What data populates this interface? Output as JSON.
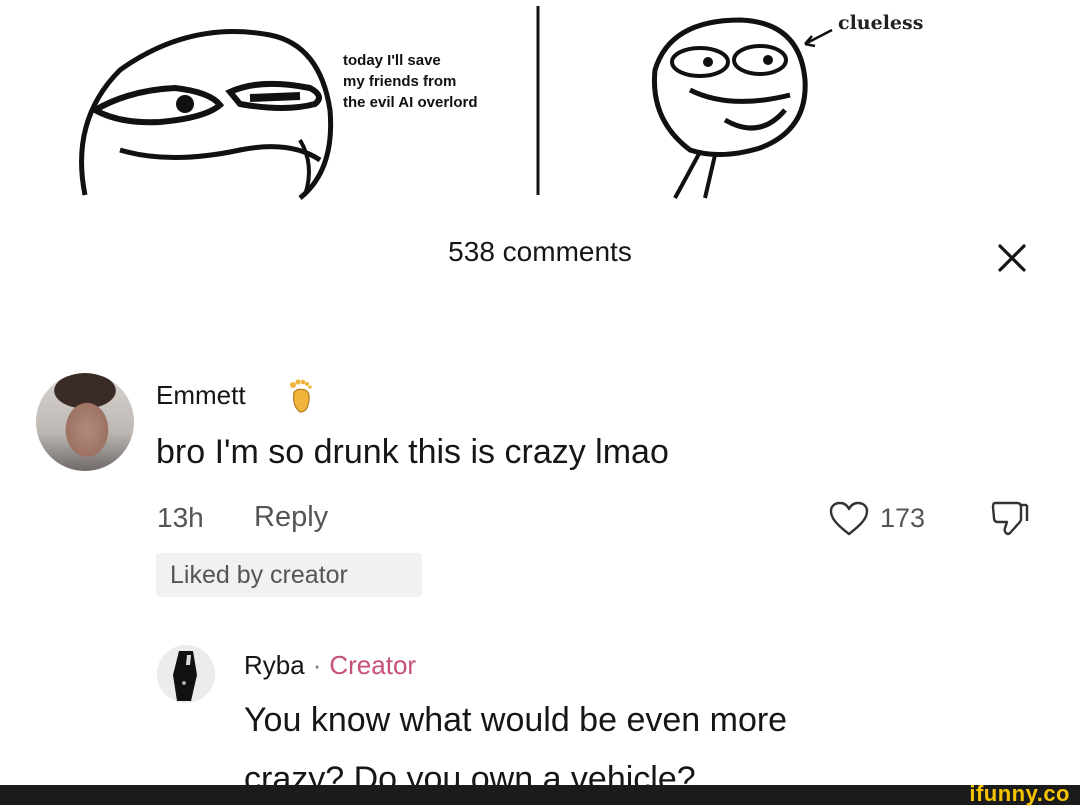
{
  "meme": {
    "caption_lines": [
      "today I'll save",
      "my friends from",
      "the evil AI overlord"
    ],
    "label": "clueless"
  },
  "comments_panel": {
    "count_label": "538 comments",
    "close_icon": "close-x-icon"
  },
  "comment_1": {
    "username": "Emmett",
    "badge_icon": "foot-emoji-icon",
    "text": "bro I'm so drunk this is crazy lmao",
    "time": "13h",
    "reply_label": "Reply",
    "likes": "173",
    "liked_by_creator_label": "Liked by creator"
  },
  "comment_2": {
    "username": "Ryba",
    "separator": "·",
    "role": "Creator",
    "text_line_1": "You know what would be even more",
    "text_line_2": "crazy? Do you own a vehicle?"
  },
  "watermark": {
    "text": "ifunny.co"
  },
  "colors": {
    "creator_pink": "#c7507a",
    "watermark_yellow": "#f5c400",
    "chip_bg": "#f1f1f2"
  }
}
